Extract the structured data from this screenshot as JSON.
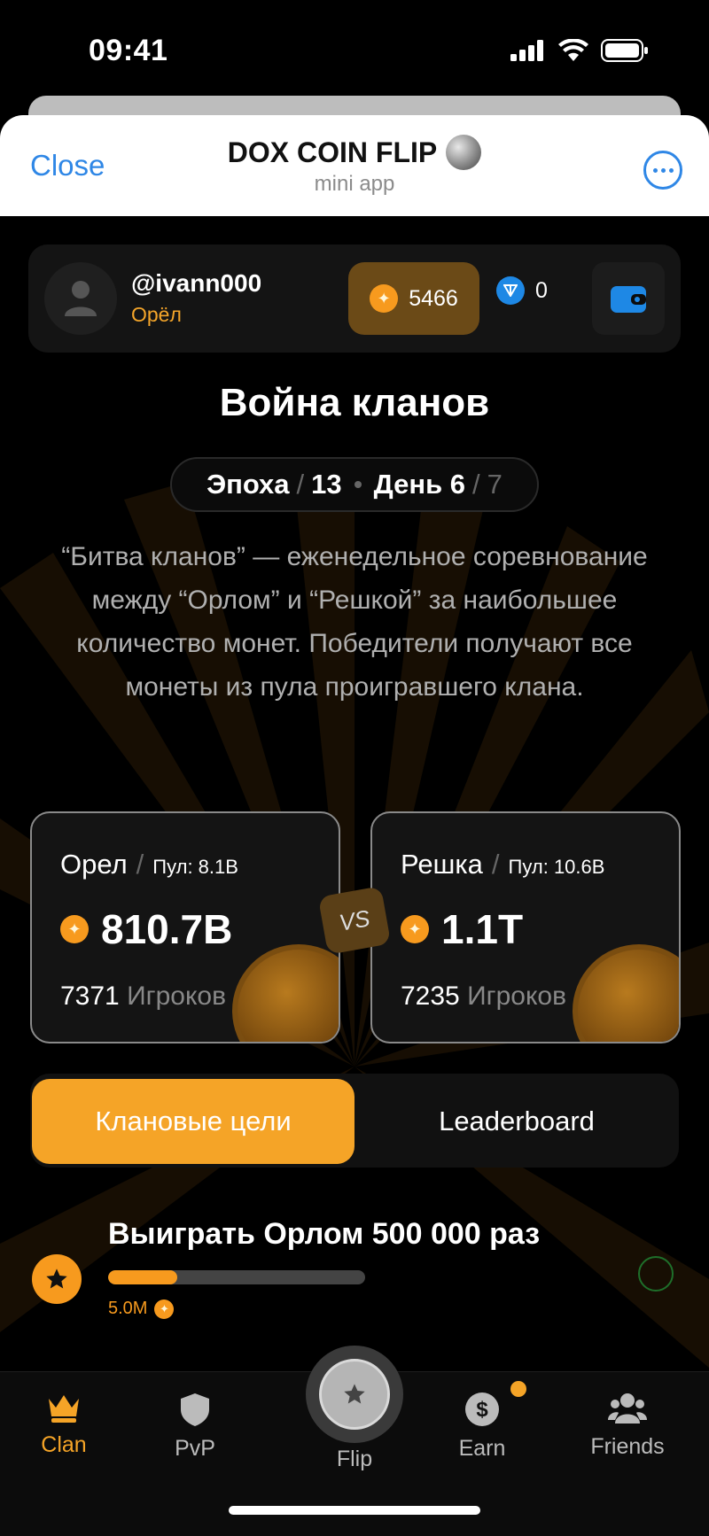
{
  "status_bar": {
    "time": "09:41"
  },
  "telegram": {
    "close_label": "Close",
    "title": "DOX COIN FLIP",
    "subtitle": "mini app",
    "more_icon": "ellipsis-icon"
  },
  "profile": {
    "username": "@ivann000",
    "clan": "Орёл",
    "coins": "5466",
    "ton": "0"
  },
  "page": {
    "title": "Война кланов",
    "epoch_label": "Эпоха",
    "epoch_value": "13",
    "day_label": "День 6",
    "day_total": "7",
    "description": "“Битва кланов” — еженедельное соревнование между “Орлом” и “Решкой” за наибольшее количество монет. Победители получают все монеты из пула проигравшего клана."
  },
  "clans": {
    "left": {
      "name": "Орел",
      "pool": "Пул: 8.1B",
      "amount": "810.7B",
      "players": "7371",
      "players_label": "Игроков"
    },
    "vs": "VS",
    "right": {
      "name": "Решка",
      "pool": "Пул: 10.6B",
      "amount": "1.1T",
      "players": "7235",
      "players_label": "Игроков"
    }
  },
  "tabs": {
    "clan_goals": "Клановые цели",
    "leaderboard": "Leaderboard"
  },
  "goal": {
    "title": "Выиграть Орлом 500 000 раз",
    "progress": 0.27,
    "reward": "5.0M"
  },
  "nav": {
    "clan": "Clan",
    "pvp": "PvP",
    "flip": "Flip",
    "earn": "Earn",
    "friends": "Friends"
  },
  "colors": {
    "accent": "#f5a427",
    "link": "#2f87e6",
    "background": "#000000"
  }
}
